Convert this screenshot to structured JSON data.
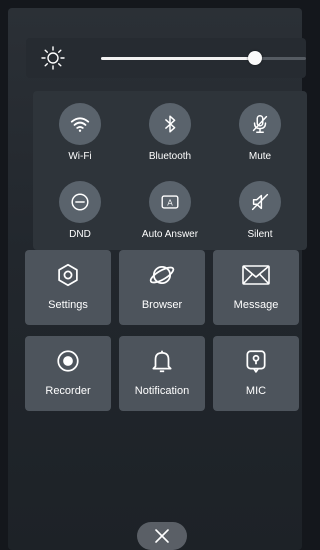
{
  "brightness": {
    "level": 0.75,
    "icon": "sun-icon"
  },
  "toggles": [
    {
      "label": "Wi-Fi",
      "icon": "wifi-icon"
    },
    {
      "label": "Bluetooth",
      "icon": "bluetooth-icon"
    },
    {
      "label": "Mute",
      "icon": "mic-muted-icon"
    },
    {
      "label": "DND",
      "icon": "dnd-icon"
    },
    {
      "label": "Auto Answer",
      "icon": "auto-answer-icon"
    },
    {
      "label": "Silent",
      "icon": "speaker-muted-icon"
    }
  ],
  "tiles": [
    {
      "label": "Settings",
      "icon": "settings-icon"
    },
    {
      "label": "Browser",
      "icon": "browser-icon"
    },
    {
      "label": "Message",
      "icon": "envelope-icon"
    },
    {
      "label": "Recorder",
      "icon": "record-icon"
    },
    {
      "label": "Notification",
      "icon": "bell-icon"
    },
    {
      "label": "MIC",
      "icon": "mic-icon"
    }
  ],
  "auto_answer_glyph": "A",
  "close": {
    "icon": "close-icon"
  },
  "colors": {
    "background": "#22272d",
    "toggle_circle": "#5a636c",
    "tile": "#4d545c",
    "slider_fill": "#f2f2f2"
  }
}
